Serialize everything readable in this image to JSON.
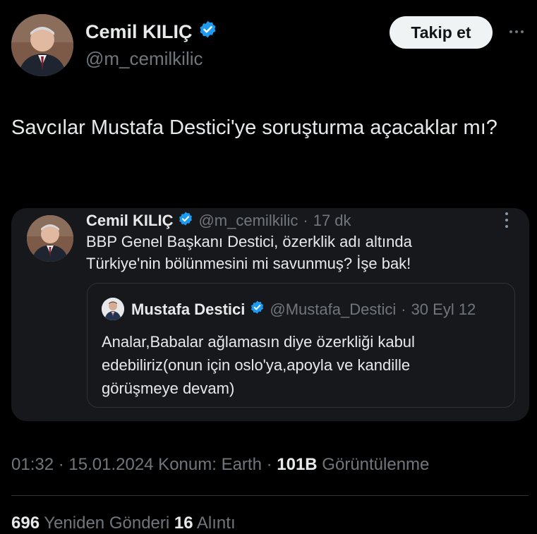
{
  "author": {
    "name": "Cemil KILIÇ",
    "handle": "@m_cemilkilic",
    "avatar_icon": "person-avatar",
    "verified_icon": "verified-badge-icon"
  },
  "actions": {
    "follow_label": "Takip et",
    "more_icon": "more-horizontal-icon"
  },
  "tweet": {
    "text": "Savcılar Mustafa Destici'ye soruşturma açacaklar mı?"
  },
  "quoted": {
    "name": "Cemil KILIÇ",
    "handle": "@m_cemilkilic",
    "separator": "·",
    "time": "17 dk",
    "text_line1": "BBP Genel Başkanı Destici, özerklik adı altında",
    "text_line2": "Türkiye'nin bölünmesini mi savunmuş? İşe bak!",
    "more_icon": "more-vertical-icon",
    "nested": {
      "name": "Mustafa Destici",
      "handle": "@Mustafa_Destici",
      "separator": "·",
      "date": "30 Eyl 12",
      "text_line1": "Analar,Babalar ağlamasın diye özerkliği kabul",
      "text_line2": "edebiliriz(onun için oslo'ya,apoyla ve kandille",
      "text_line3": "görüşmeye devam)"
    }
  },
  "meta": {
    "time": "01:32",
    "sep1": " · ",
    "date": "15.01.2024",
    "location": " Konum: Earth",
    "sep2": " · ",
    "views_count": "101B",
    "views_label": " Görüntülenme"
  },
  "stats": {
    "reposts_count": "696",
    "reposts_label": " Yeniden Gönderi ",
    "quotes_count": "16",
    "quotes_label": " Alıntı"
  },
  "colors": {
    "background": "#000000",
    "text": "#e7e9ea",
    "secondary": "#71767b",
    "verified": "#1d9bf0",
    "card": "#16181c"
  }
}
